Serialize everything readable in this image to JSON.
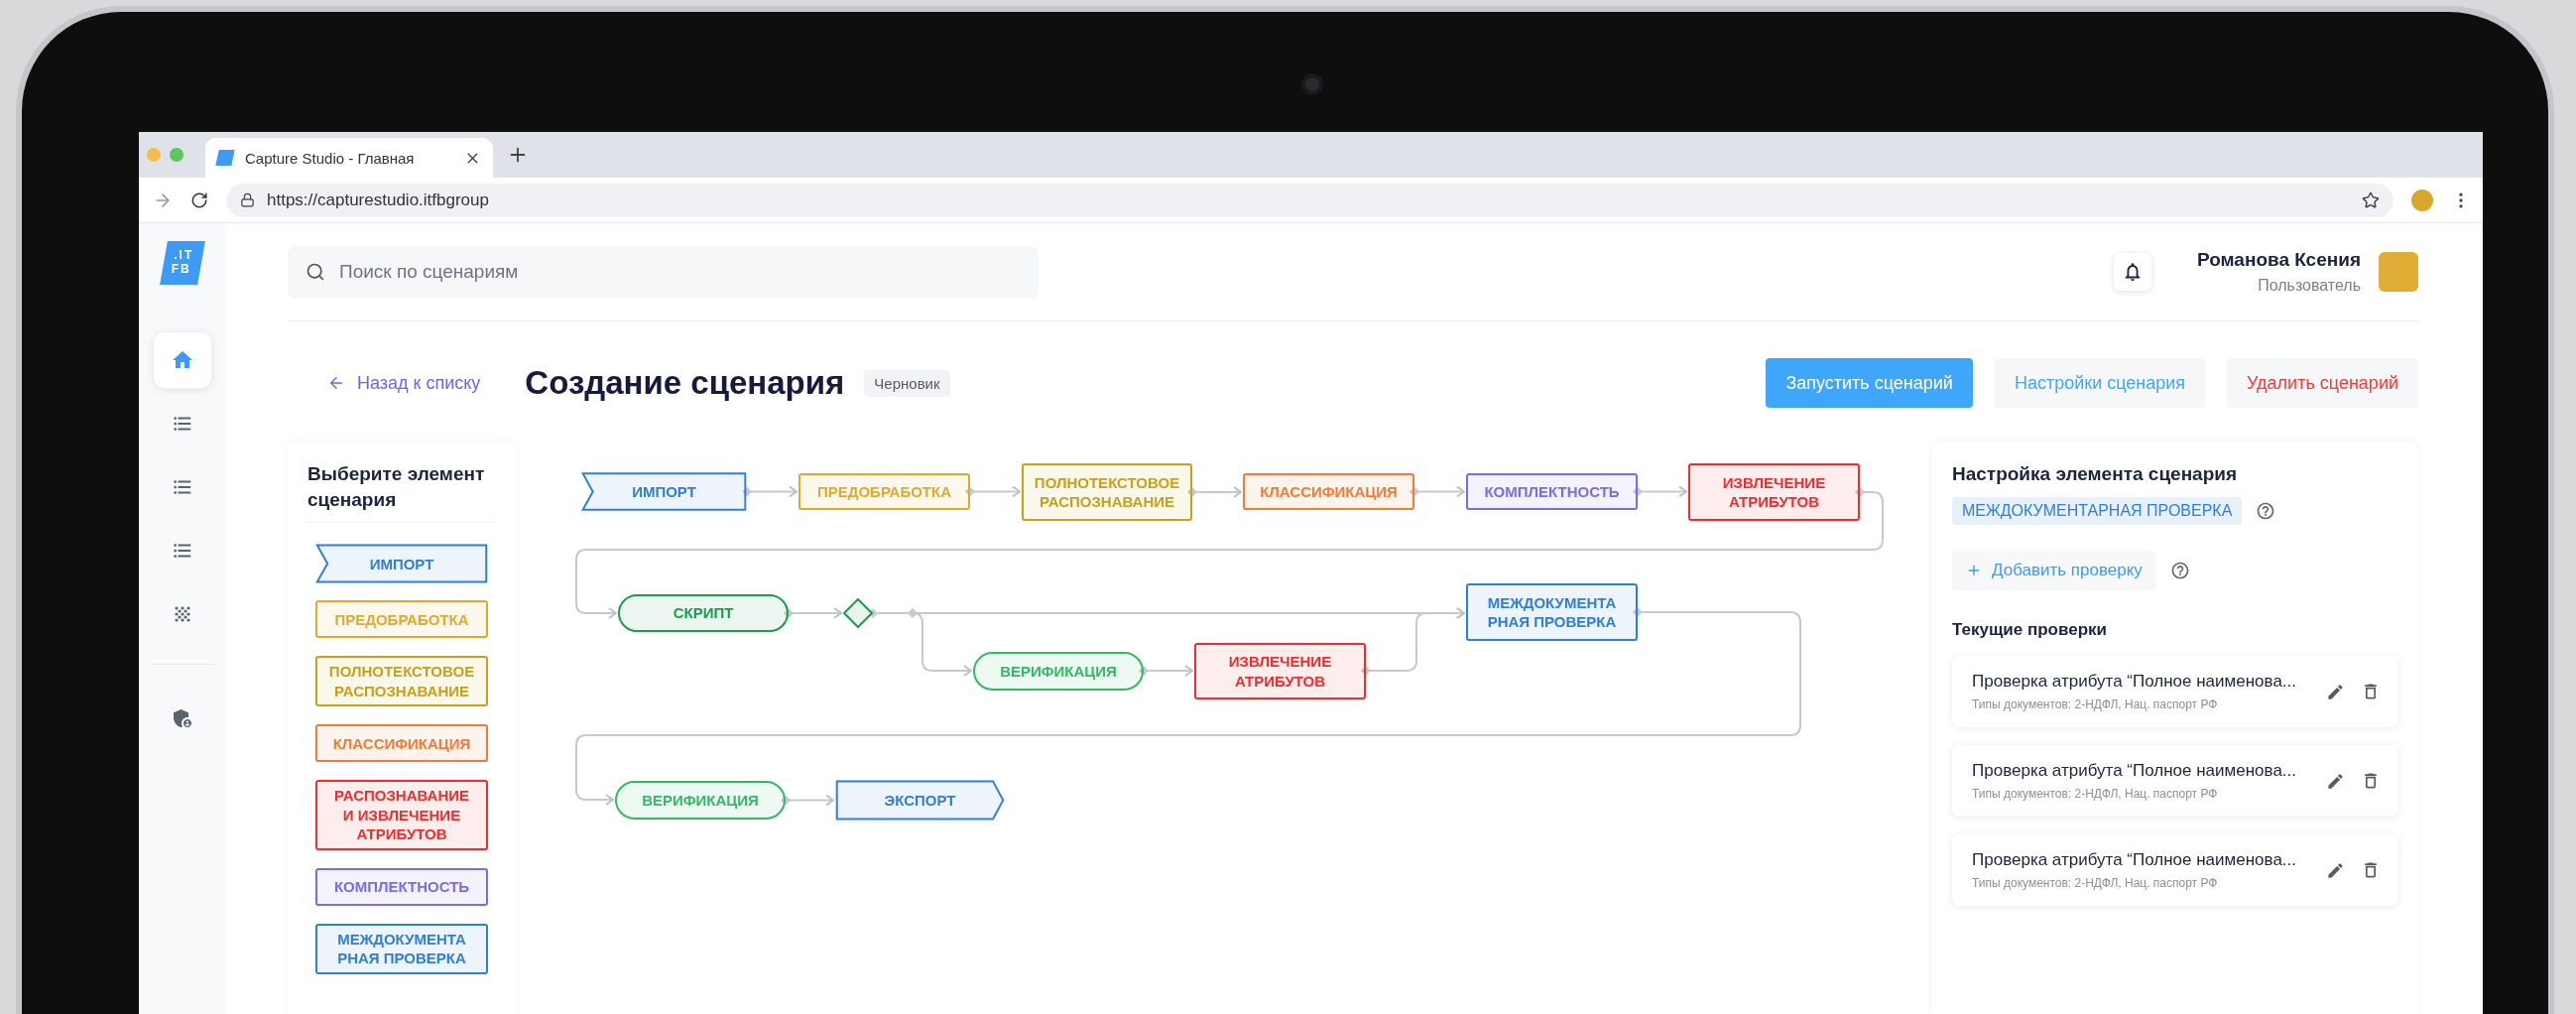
{
  "browser": {
    "tab_title": "Capture Studio - Главная",
    "url": "https://capturestudio.itfbgroup"
  },
  "sidebar": {
    "logo": [
      ".IT",
      "FB"
    ],
    "items": [
      {
        "kind": "home",
        "selected": true
      },
      {
        "kind": "list",
        "selected": false
      },
      {
        "kind": "list",
        "selected": false
      },
      {
        "kind": "list",
        "selected": false
      },
      {
        "kind": "grid",
        "selected": false
      },
      {
        "kind": "shield",
        "selected": false
      }
    ]
  },
  "header": {
    "search_placeholder": "Поиск по сценариям",
    "user": {
      "name": "Романова Ксения",
      "role": "Пользователь"
    }
  },
  "page": {
    "back_link": "Назад к списку",
    "title": "Создание сценария",
    "status": "Черновик",
    "actions": [
      {
        "label": "Запустить сценарий",
        "kind": "primary"
      },
      {
        "label": "Настройки сценария",
        "kind": "secondary"
      },
      {
        "label": "Удалить сценарий",
        "kind": "danger"
      }
    ]
  },
  "palette": {
    "title": "Выберите элемент сценария",
    "items": [
      {
        "label": "ИМПОРТ",
        "kind": "input",
        "color": "#2f7fd6"
      },
      {
        "label": "ПРЕДОБРАБОТКА",
        "kind": "box",
        "color": "#e0a92e"
      },
      {
        "label": "ПОЛНОТЕКСТОВОЕ\nРАСПОЗНАВАНИЕ",
        "kind": "box",
        "color": "#c9a01c"
      },
      {
        "label": "КЛАССИФИКАЦИЯ",
        "kind": "box",
        "color": "#f47a35"
      },
      {
        "label": "РАСПОЗНАВАНИЕ\nИ ИЗВЛЕЧЕНИЕ\nАТРИБУТОВ",
        "kind": "box",
        "color": "#ee2d2d"
      },
      {
        "label": "КОМПЛЕКТНОСТЬ",
        "kind": "box",
        "color": "#7a6be8"
      },
      {
        "label": "МЕЖДОКУМЕНТА\nРНАЯ ПРОВЕРКА",
        "kind": "box",
        "color": "#2f7fd6"
      }
    ]
  },
  "flow": {
    "nodes": [
      {
        "label": "ИМПОРТ",
        "kind": "input",
        "color": "#2f7fd6"
      },
      {
        "label": "ПРЕДОБРАБОТКА",
        "kind": "box",
        "color": "#e0a92e"
      },
      {
        "label": "ПОЛНОТЕКСТОВОЕ\nРАСПОЗНАВАНИЕ",
        "kind": "box",
        "color": "#c9a01c"
      },
      {
        "label": "КЛАССИФИКАЦИЯ",
        "kind": "box",
        "color": "#f47a35"
      },
      {
        "label": "КОМПЛЕКТНОСТЬ",
        "kind": "box",
        "color": "#7a6be8"
      },
      {
        "label": "ИЗВЛЕЧЕНИЕ\nАТРИБУТОВ",
        "kind": "box",
        "color": "#ee2d2d"
      },
      {
        "label": "СКРИПТ",
        "kind": "pill",
        "color": "#1e9a4e"
      },
      {
        "label": "ВЕРИФИКАЦИЯ",
        "kind": "pill",
        "color": "#33b865"
      },
      {
        "label": "ИЗВЛЕЧЕНИЕ\nАТРИБУТОВ",
        "kind": "box",
        "color": "#ee2d2d"
      },
      {
        "label": "МЕЖДОКУМЕНТА\nРНАЯ ПРОВЕРКА",
        "kind": "box",
        "color": "#2f7fd6"
      },
      {
        "label": "ВЕРИФИКАЦИЯ",
        "kind": "pill",
        "color": "#33b865"
      },
      {
        "label": "ЭКСПОРТ",
        "kind": "output",
        "color": "#2f7fd6"
      }
    ]
  },
  "settings": {
    "title": "Настройка элемента сценария",
    "element": "МЕЖДОКУМЕНТАРНАЯ ПРОВЕРКА",
    "add_button": "Добавить проверку",
    "section": "Текущие проверки",
    "checks": [
      {
        "title": "Проверка атрибута “Полное наименова...",
        "subtitle": "Типы документов: 2-НДФЛ, Нац. паспорт РФ"
      },
      {
        "title": "Проверка атрибута “Полное наименова...",
        "subtitle": "Типы документов: 2-НДФЛ, Нац. паспорт РФ"
      },
      {
        "title": "Проверка атрибута “Полное наименова...",
        "subtitle": "Типы документов: 2-НДФЛ, Нац. паспорт РФ"
      }
    ]
  }
}
